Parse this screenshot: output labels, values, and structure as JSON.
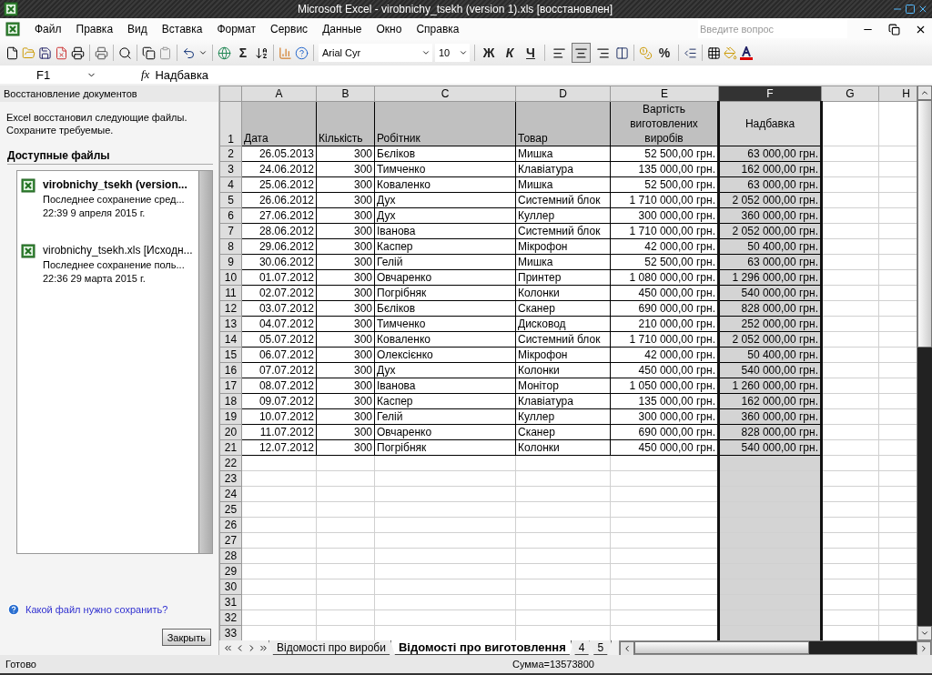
{
  "window": {
    "title": "Microsoft Excel - virobnichy_tsekh (version 1).xls  [восстановлен]"
  },
  "menu": {
    "items": [
      "Файл",
      "Правка",
      "Вид",
      "Вставка",
      "Формат",
      "Сервис",
      "Данные",
      "Окно",
      "Справка"
    ],
    "help_placeholder": "Введите вопрос"
  },
  "toolbar": {
    "sum": "Σ",
    "font": "Arial Cyr",
    "size": "10",
    "bold": "Ж",
    "italic": "К",
    "underline": "Ч",
    "percent": "%",
    "align_buttons": [
      {
        "selected": false
      },
      {
        "selected": true
      },
      {
        "selected": false
      }
    ]
  },
  "formula_bar": {
    "name_box": "F1",
    "fx": "fx",
    "value": "Надбавка"
  },
  "task_pane": {
    "title": "Восстановление документов",
    "message": [
      "Excel восстановил следующие файлы.",
      "Сохраните требуемые."
    ],
    "section": "Доступные файлы",
    "files": [
      {
        "name": "virobnichy_tsekh (version...",
        "saved": "Последнее сохранение сред...",
        "time": "22:39 9 апреля 2015 г.",
        "selected": true
      },
      {
        "name": "virobnichy_tsekh.xls  [Исходн...",
        "saved": "Последнее сохранение поль...",
        "time": "22:36 29 марта 2015 г.",
        "selected": false
      }
    ],
    "help_link": "Какой файл нужно сохранить?",
    "close_button": "Закрыть"
  },
  "sheet": {
    "columns": [
      {
        "label": "A",
        "selected": false
      },
      {
        "label": "B",
        "selected": false
      },
      {
        "label": "C",
        "selected": false
      },
      {
        "label": "D",
        "selected": false
      },
      {
        "label": "E",
        "selected": false
      },
      {
        "label": "F",
        "selected": true
      },
      {
        "label": "G",
        "selected": false
      },
      {
        "label": "H",
        "selected": false
      }
    ],
    "header_row": {
      "number": "1",
      "cells": [
        "Дата",
        "Кількість",
        "Робітник",
        "Товар",
        "Вартість виготовлених виробів",
        "Надбавка"
      ]
    },
    "rows": [
      {
        "number": "2",
        "cells": [
          "26.05.2013",
          "300",
          "Бєліков",
          "Мишка",
          "52 500,00 грн.",
          "63 000,00 грн."
        ]
      },
      {
        "number": "3",
        "cells": [
          "24.06.2012",
          "300",
          "Тимченко",
          "Клавіатура",
          "135 000,00 грн.",
          "162 000,00 грн."
        ]
      },
      {
        "number": "4",
        "cells": [
          "25.06.2012",
          "300",
          "Коваленко",
          "Мишка",
          "52 500,00 грн.",
          "63 000,00 грн."
        ]
      },
      {
        "number": "5",
        "cells": [
          "26.06.2012",
          "300",
          "Дух",
          "Системний блок",
          "1 710 000,00 грн.",
          "2 052 000,00 грн."
        ]
      },
      {
        "number": "6",
        "cells": [
          "27.06.2012",
          "300",
          "Дух",
          "Куллер",
          "300 000,00 грн.",
          "360 000,00 грн."
        ]
      },
      {
        "number": "7",
        "cells": [
          "28.06.2012",
          "300",
          "Іванова",
          "Системний блок",
          "1 710 000,00 грн.",
          "2 052 000,00 грн."
        ]
      },
      {
        "number": "8",
        "cells": [
          "29.06.2012",
          "300",
          "Каспер",
          "Мікрофон",
          "42 000,00 грн.",
          "50 400,00 грн."
        ]
      },
      {
        "number": "9",
        "cells": [
          "30.06.2012",
          "300",
          "Гелій",
          "Мишка",
          "52 500,00 грн.",
          "63 000,00 грн."
        ]
      },
      {
        "number": "10",
        "cells": [
          "01.07.2012",
          "300",
          "Овчаренко",
          "Принтер",
          "1 080 000,00 грн.",
          "1 296 000,00 грн."
        ]
      },
      {
        "number": "11",
        "cells": [
          "02.07.2012",
          "300",
          "Погрібняк",
          "Колонки",
          "450 000,00 грн.",
          "540 000,00 грн."
        ]
      },
      {
        "number": "12",
        "cells": [
          "03.07.2012",
          "300",
          "Бєліков",
          "Сканер",
          "690 000,00 грн.",
          "828 000,00 грн."
        ]
      },
      {
        "number": "13",
        "cells": [
          "04.07.2012",
          "300",
          "Тимченко",
          "Дисковод",
          "210 000,00 грн.",
          "252 000,00 грн."
        ]
      },
      {
        "number": "14",
        "cells": [
          "05.07.2012",
          "300",
          "Коваленко",
          "Системний блок",
          "1 710 000,00 грн.",
          "2 052 000,00 грн."
        ]
      },
      {
        "number": "15",
        "cells": [
          "06.07.2012",
          "300",
          "Олексієнко",
          "Мікрофон",
          "42 000,00 грн.",
          "50 400,00 грн."
        ]
      },
      {
        "number": "16",
        "cells": [
          "07.07.2012",
          "300",
          "Дух",
          "Колонки",
          "450 000,00 грн.",
          "540 000,00 грн."
        ]
      },
      {
        "number": "17",
        "cells": [
          "08.07.2012",
          "300",
          "Іванова",
          "Монітор",
          "1 050 000,00 грн.",
          "1 260 000,00 грн."
        ]
      },
      {
        "number": "18",
        "cells": [
          "09.07.2012",
          "300",
          "Каспер",
          "Клавіатура",
          "135 000,00 грн.",
          "162 000,00 грн."
        ]
      },
      {
        "number": "19",
        "cells": [
          "10.07.2012",
          "300",
          "Гелій",
          "Куллер",
          "300 000,00 грн.",
          "360 000,00 грн."
        ]
      },
      {
        "number": "20",
        "cells": [
          "11.07.2012",
          "300",
          "Овчаренко",
          "Сканер",
          "690 000,00 грн.",
          "828 000,00 грн."
        ]
      },
      {
        "number": "21",
        "cells": [
          "12.07.2012",
          "300",
          "Погрібняк",
          "Колонки",
          "450 000,00 грн.",
          "540 000,00 грн."
        ]
      }
    ],
    "blank_rows": [
      "22",
      "23",
      "24",
      "25",
      "26",
      "27",
      "28",
      "29",
      "30",
      "31",
      "32",
      "33"
    ],
    "tabs": [
      {
        "label": "Відомості про вироби",
        "selected": false
      },
      {
        "label": "Відомості про виготовлення",
        "selected": true
      },
      {
        "label": "4",
        "selected": false
      },
      {
        "label": "5",
        "selected": false
      }
    ]
  },
  "status_bar": {
    "state": "Готово",
    "sum": "Сумма=13573800"
  }
}
